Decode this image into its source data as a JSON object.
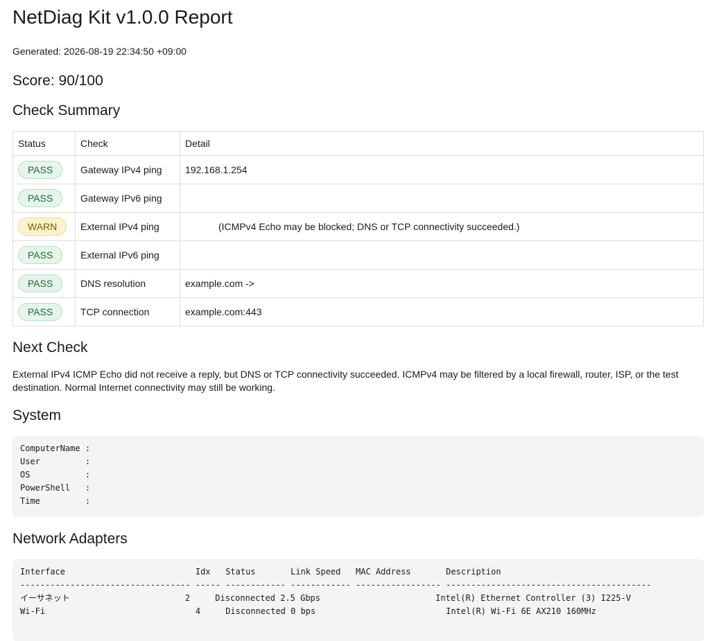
{
  "report": {
    "title": "NetDiag Kit v1.0.0 Report",
    "generated": "Generated: 2026-08-19 22:34:50 +09:00",
    "score": "Score: 90/100"
  },
  "summary": {
    "heading": "Check Summary",
    "headers": {
      "status": "Status",
      "check": "Check",
      "detail": "Detail"
    },
    "rows": [
      {
        "status": "PASS",
        "check": "Gateway IPv4 ping",
        "detail": "192.168.1.254"
      },
      {
        "status": "PASS",
        "check": "Gateway IPv6 ping",
        "detail": ""
      },
      {
        "status": "WARN",
        "check": "External IPv4 ping",
        "detail": "(ICMPv4 Echo may be blocked; DNS or TCP connectivity succeeded.)"
      },
      {
        "status": "PASS",
        "check": "External IPv6 ping",
        "detail": ""
      },
      {
        "status": "PASS",
        "check": "DNS resolution",
        "detail": "example.com ->"
      },
      {
        "status": "PASS",
        "check": "TCP connection",
        "detail": "example.com:443"
      }
    ]
  },
  "next_check": {
    "heading": "Next Check",
    "text": "External IPv4 ICMP Echo did not receive a reply, but DNS or TCP connectivity succeeded. ICMPv4 may be filtered by a local firewall, router, ISP, or the test destination. Normal Internet connectivity may still be working."
  },
  "system": {
    "heading": "System",
    "lines": [
      "ComputerName :",
      "User         :",
      "OS           :",
      "PowerShell   :",
      "Time         :"
    ]
  },
  "adapters": {
    "heading": "Network Adapters",
    "lines": [
      "Interface                          Idx   Status       Link Speed   MAC Address       Description",
      "---------------------------------- ----- ------------ ------------ ----------------- -----------------------------------------",
      "イーサネット                       2     Disconnected 2.5 Gbps                       Intel(R) Ethernet Controller (3) I225-V",
      "Wi-Fi                              4     Disconnected 0 bps                          Intel(R) Wi-Fi 6E AX210 160MHz"
    ]
  },
  "colors": {
    "pass_bg": "#e6f4ea",
    "pass_text": "#1e6b32",
    "warn_bg": "#fff3cd",
    "warn_text": "#7a5a00",
    "code_bg": "#f4f4f4"
  }
}
